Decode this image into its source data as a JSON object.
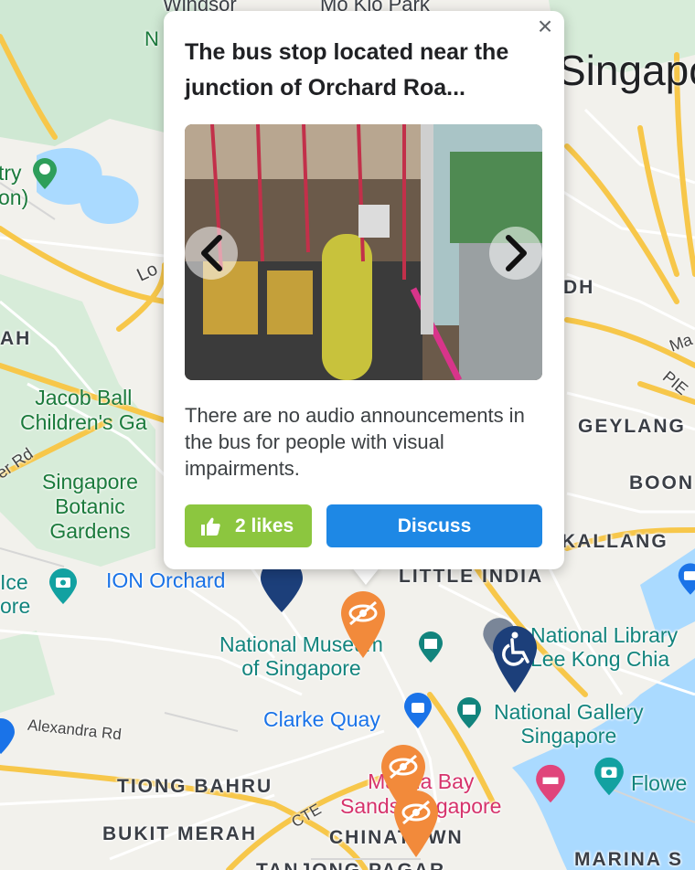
{
  "map": {
    "labels": {
      "windsor": "Windsor",
      "mo_kio_park": "Mo Kio Park",
      "n": "N",
      "singapore": "Singapo",
      "try_on": "try\non)",
      "lo": "Lo",
      "ah": "AH",
      "dh": "DH",
      "ma": "Ma",
      "pie": "PIE",
      "jacob_ballas": "Jacob Ball\nChildren's Ga",
      "er_rd": "er Rd",
      "botanic": "Singapore\nBotanic\nGardens",
      "geylang": "GEYLANG",
      "boon": "BOON",
      "kallang": "KALLANG",
      "ice_ore": "Ice\nore",
      "ion_orchard": "ION Orchard",
      "little_india": "LITTLE INDIA",
      "nat_museum": "National Museum\nof Singapore",
      "nat_library": "National Library\nLee Kong Chia",
      "alexandra": "Alexandra Rd",
      "clarke_quay": "Clarke Quay",
      "nat_gallery": "National Gallery\nSingapore",
      "flowe": "Flowe",
      "tiong_bahru": "TIONG BAHRU",
      "marina_bay": "Marina Bay\nSands Singapore",
      "cte": "CTE",
      "bukit_merah": "BUKIT MERAH",
      "chinatown": "CHINATOWN",
      "tanjong_pagar": "TANJONG PAGAR",
      "marina_s": "MARINA S"
    },
    "colors": {
      "land": "#f2f1ec",
      "park": "#cfe8d3",
      "water": "#aadaff",
      "road_major": "#f7c74a",
      "road_minor": "#ffffff",
      "pin_orange": "#f28a3b",
      "pin_navy": "#1c3f7a"
    },
    "icons": [
      "visibility-off-icon",
      "wheelchair-icon",
      "museum-icon",
      "camera-icon",
      "shopping-icon",
      "hotel-icon",
      "hiking-icon"
    ]
  },
  "popup": {
    "title": "The bus stop located near the junction of Orchard Roa...",
    "close_label": "×",
    "description": "There are no audio announcements in the bus for people with visual impairments.",
    "likes_label": "2 likes",
    "discuss_label": "Discuss",
    "colors": {
      "likes": "#8cc63f",
      "discuss": "#1e88e5"
    }
  }
}
